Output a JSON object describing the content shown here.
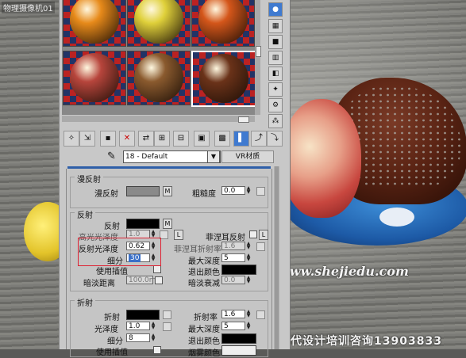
{
  "viewport": {
    "label": "物理摄像机01",
    "watermark": "www.shejiedu.com",
    "watermark2": "代设计培训咨询13903833"
  },
  "slots": [
    {
      "name": "orange",
      "color": "#e78a1a"
    },
    {
      "name": "lemon",
      "color": "#dfd03a"
    },
    {
      "name": "blood-orange",
      "color": "#d4561a"
    },
    {
      "name": "apple",
      "color": "#b7453c"
    },
    {
      "name": "bread",
      "color": "#8a5a2e"
    },
    {
      "name": "chocolate",
      "color": "#6a3219"
    }
  ],
  "toolbar": {
    "buttons": [
      "get-material",
      "put-to-scene",
      "assign",
      "reset",
      "copy",
      "unique",
      "put-library",
      "mat-id",
      "show-map",
      "show-end",
      "go-parent",
      "go-sibling"
    ]
  },
  "namebar": {
    "material_name": "18 - Default",
    "type_button": "VR材质"
  },
  "diffuse": {
    "title": "漫反射",
    "diffuse_label": "漫反射",
    "m": "M",
    "roughness_label": "粗糙度",
    "roughness_value": "0.0",
    "diffuse_color": "#8a8a8a"
  },
  "reflect": {
    "title": "反射",
    "reflect_label": "反射",
    "m": "M",
    "hilight_gloss_label": "高光光泽度",
    "hilight_gloss_value": "1.0",
    "l_btn": "L",
    "fresnel_label": "菲涅耳反射",
    "refl_gloss_label": "反射光泽度",
    "refl_gloss_value": "0.62",
    "fresnel_ior_label": "菲涅耳折射率",
    "fresnel_ior_value": "1.6",
    "subdivs_label": "细分",
    "subdivs_value": "30",
    "max_depth_label": "最大深度",
    "max_depth_value": "5",
    "use_interp_label": "使用插值",
    "exit_color_label": "退出颜色",
    "dim_distance_label": "暗淡距离",
    "dim_distance_value": "100.0m",
    "dim_falloff_label": "暗淡衰减",
    "dim_falloff_value": "0.0",
    "reflect_color": "#000000",
    "exit_color": "#000000"
  },
  "refract": {
    "title": "折射",
    "refract_label": "折射",
    "ior_label": "折射率",
    "ior_value": "1.6",
    "gloss_label": "光泽度",
    "gloss_value": "1.0",
    "max_depth_label": "最大深度",
    "max_depth_value": "5",
    "subdivs_label": "细分",
    "subdivs_value": "8",
    "exit_color_label": "退出颜色",
    "use_interp_label": "使用插值",
    "fog_color_label": "烟雾颜色",
    "refract_color": "#000000"
  }
}
